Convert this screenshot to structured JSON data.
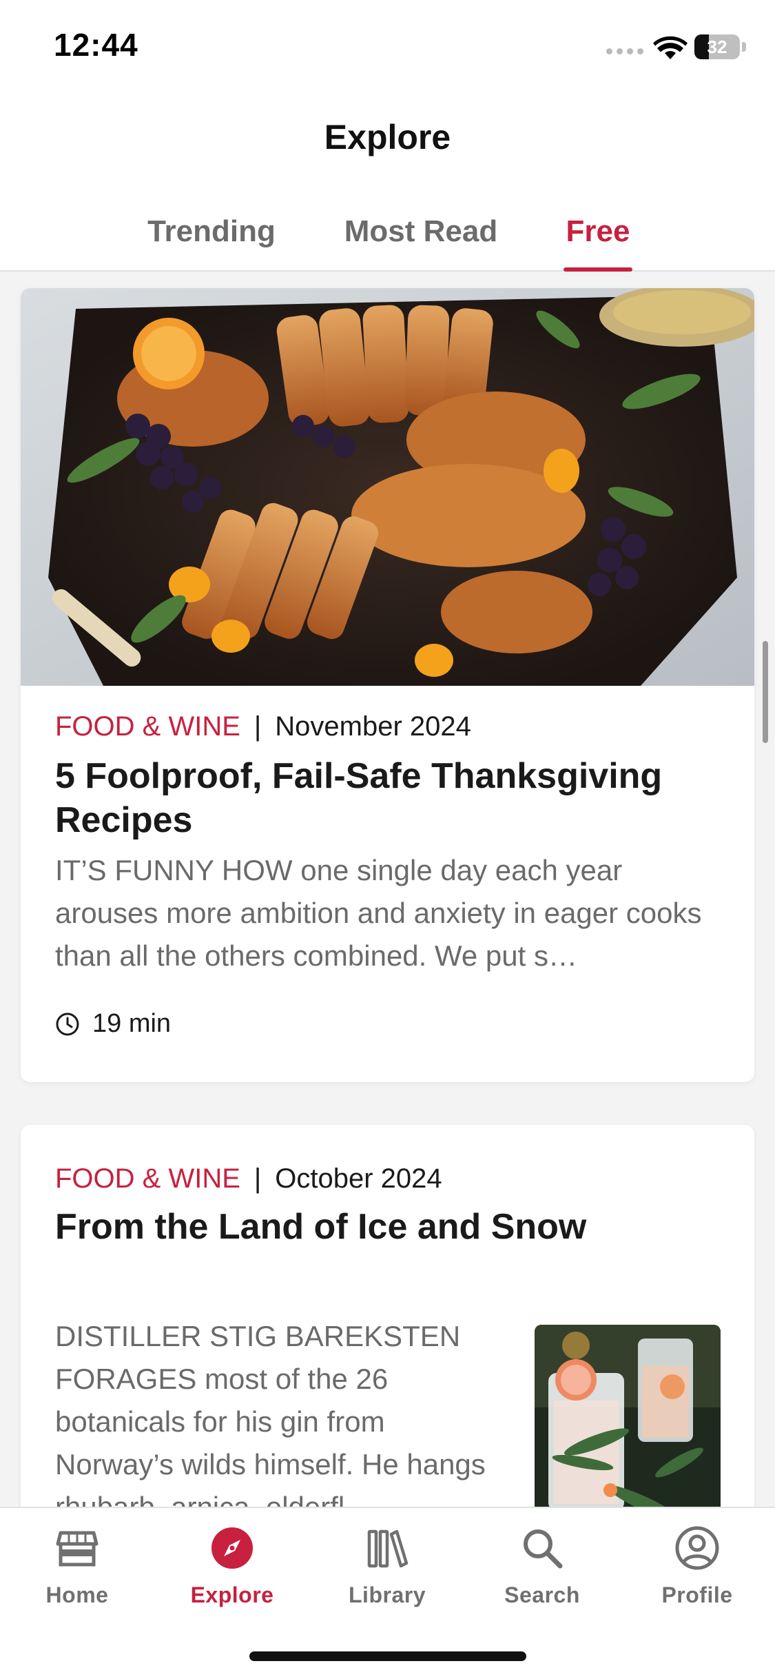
{
  "status_bar": {
    "time": "12:44",
    "battery": "32",
    "battery_level": 0.32
  },
  "header": {
    "title": "Explore"
  },
  "tabs": [
    {
      "label": "Trending",
      "active": false
    },
    {
      "label": "Most Read",
      "active": false
    },
    {
      "label": "Free",
      "active": true
    }
  ],
  "articles": [
    {
      "source": "FOOD & WINE",
      "separator": "|",
      "date": "November 2024",
      "title": "5 Foolproof, Fail-Safe Thanksgiving Recipes",
      "excerpt": "IT’S FUNNY HOW one single day each year arouses more ambition and anxiety in eager cooks than all the others combined. We put s…",
      "read_time": "19 min",
      "image": "roast-turkey-platter"
    },
    {
      "source": "FOOD & WINE",
      "separator": "|",
      "date": "October 2024",
      "title": "From the Land of Ice and Snow",
      "excerpt": "DISTILLER STIG BAREKSTEN FORAGES most of the 26 botanicals for his gin from Norway’s wilds himself. He hangs rhubarb, arnica, elderfl",
      "image": "gin-cocktails"
    }
  ],
  "bottom_nav": [
    {
      "label": "Home",
      "icon": "storefront-icon",
      "active": false
    },
    {
      "label": "Explore",
      "icon": "compass-icon",
      "active": true
    },
    {
      "label": "Library",
      "icon": "books-icon",
      "active": false
    },
    {
      "label": "Search",
      "icon": "search-icon",
      "active": false
    },
    {
      "label": "Profile",
      "icon": "user-circle-icon",
      "active": false
    }
  ],
  "colors": {
    "accent": "#c8203f",
    "text": "#1a1a1a",
    "muted": "#6a6a6a",
    "background": "#f3f3f3"
  }
}
